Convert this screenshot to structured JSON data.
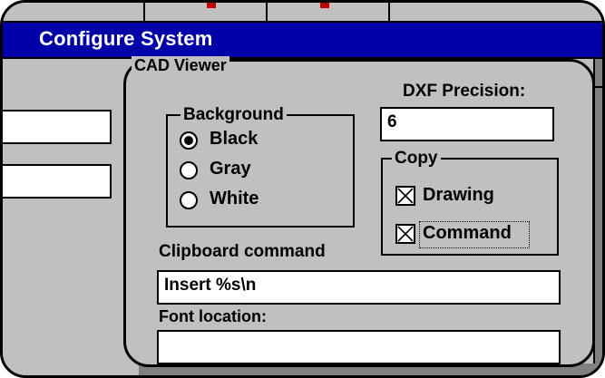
{
  "window": {
    "title": "Configure System"
  },
  "colors": {
    "title_bar": "#0000a8",
    "face": "#c0c0c0",
    "field": "#ffffff",
    "accent_marks": "#c00000"
  },
  "cad_viewer": {
    "label": "CAD Viewer",
    "background": {
      "label": "Background",
      "options": [
        {
          "label": "Black",
          "selected": true
        },
        {
          "label": "Gray",
          "selected": false
        },
        {
          "label": "White",
          "selected": false
        }
      ]
    },
    "dxf_precision": {
      "label": "DXF Precision:",
      "value": "6"
    },
    "copy": {
      "label": "Copy",
      "options": [
        {
          "label": "Drawing",
          "checked": true
        },
        {
          "label": "Command",
          "checked": true,
          "focused": true
        }
      ]
    },
    "clipboard_command": {
      "label": "Clipboard command",
      "value": "Insert %s\\n"
    },
    "font_location": {
      "label": "Font location:",
      "value": ""
    }
  }
}
